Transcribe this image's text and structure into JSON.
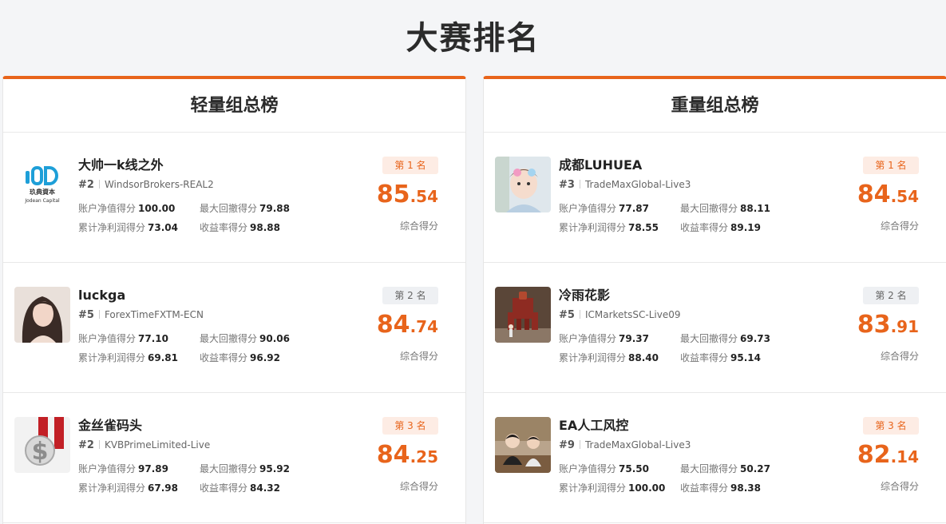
{
  "page_title": "大赛排名",
  "colors": {
    "accent": "#e8641b",
    "badge_first_bg": "#fdece4",
    "badge_second_bg": "#eef0f3"
  },
  "labels": {
    "equity": "账户净值得分",
    "drawdown": "最大回撤得分",
    "profit": "累计净利润得分",
    "return": "收益率得分",
    "composite": "综合得分"
  },
  "panels": [
    {
      "title": "轻量组总榜",
      "entries": [
        {
          "name": "大帅一k线之外",
          "rank": "#2",
          "broker": "WindsorBrokers-REAL2",
          "badge": "第 1 名",
          "score_int": "85",
          "score_dec": ".54",
          "equity": "100.00",
          "drawdown": "79.88",
          "profit": "73.04",
          "return": "98.88",
          "avatar": "jodean-capital-logo",
          "logo_text_cn": "玖典資本",
          "logo_text_en": "Jodean Capital"
        },
        {
          "name": "luckga",
          "rank": "#5",
          "broker": "ForexTimeFXTM-ECN",
          "badge": "第 2 名",
          "score_int": "84",
          "score_dec": ".74",
          "equity": "77.10",
          "drawdown": "90.06",
          "profit": "69.81",
          "return": "96.92",
          "avatar": "woman-portrait"
        },
        {
          "name": "金丝雀码头",
          "rank": "#2",
          "broker": "KVBPrimeLimited-Live",
          "badge": "第 3 名",
          "score_int": "84",
          "score_dec": ".25",
          "equity": "97.89",
          "drawdown": "95.92",
          "profit": "67.98",
          "return": "84.32",
          "avatar": "dollar-sign-image"
        }
      ]
    },
    {
      "title": "重量组总榜",
      "entries": [
        {
          "name": "成都LUHUEA",
          "rank": "#3",
          "broker": "TradeMaxGlobal-Live3",
          "badge": "第 1 名",
          "score_int": "84",
          "score_dec": ".54",
          "equity": "77.87",
          "drawdown": "88.11",
          "profit": "78.55",
          "return": "89.19",
          "avatar": "baby-photo"
        },
        {
          "name": "冷雨花影",
          "rank": "#5",
          "broker": "ICMarketsSC-Live09",
          "badge": "第 2 名",
          "score_int": "83",
          "score_dec": ".91",
          "equity": "79.37",
          "drawdown": "69.73",
          "profit": "88.40",
          "return": "95.14",
          "avatar": "robot-statue-photo"
        },
        {
          "name": "EA人工风控",
          "rank": "#9",
          "broker": "TradeMaxGlobal-Live3",
          "badge": "第 3 名",
          "score_int": "82",
          "score_dec": ".14",
          "equity": "75.50",
          "drawdown": "50.27",
          "profit": "100.00",
          "return": "98.38",
          "avatar": "children-photo"
        }
      ]
    }
  ]
}
